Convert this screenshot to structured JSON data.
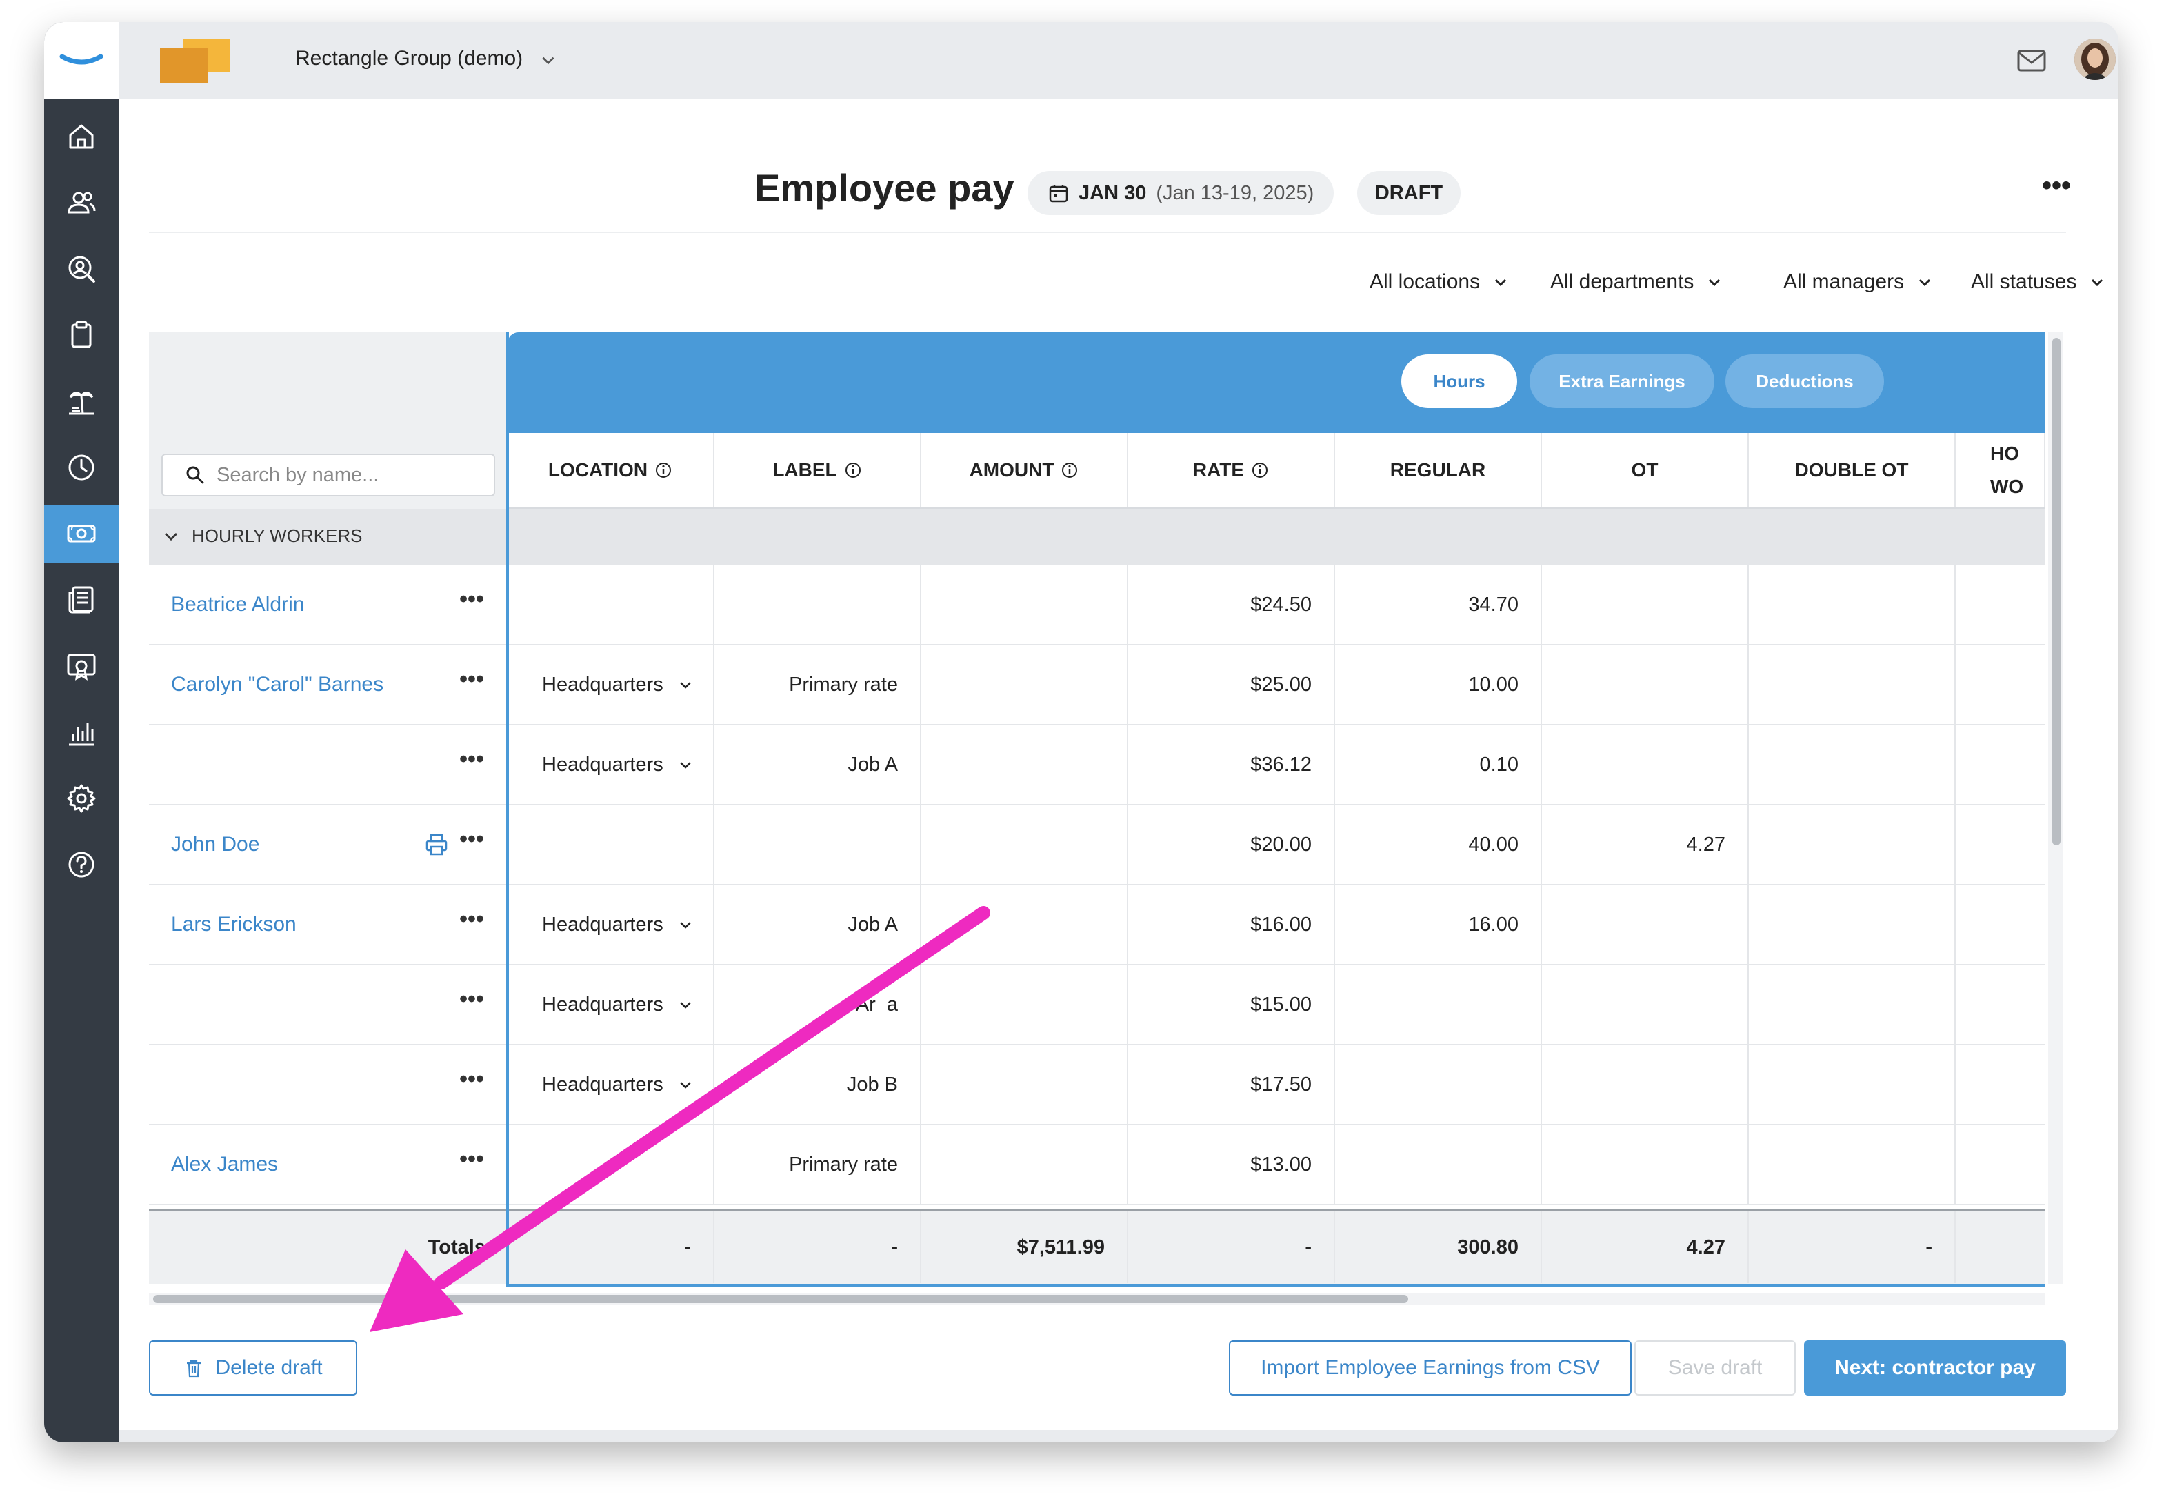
{
  "app": {
    "company_name": "Rectangle Group (demo)"
  },
  "sidebar": {
    "items": [
      {
        "icon": "home-icon"
      },
      {
        "icon": "people-icon"
      },
      {
        "icon": "search-person-icon"
      },
      {
        "icon": "clipboard-icon"
      },
      {
        "icon": "vacation-icon"
      },
      {
        "icon": "clock-icon"
      },
      {
        "icon": "payroll-icon",
        "active": true
      },
      {
        "icon": "reports-icon"
      },
      {
        "icon": "certificate-icon"
      },
      {
        "icon": "chart-icon"
      },
      {
        "icon": "gear-icon"
      },
      {
        "icon": "help-icon"
      }
    ]
  },
  "header": {
    "title": "Employee pay",
    "date_bold": "JAN 30",
    "date_range": "(Jan 13-19, 2025)",
    "status": "DRAFT",
    "more": "•••"
  },
  "filters": [
    "All locations",
    "All departments",
    "All managers",
    "All statuses"
  ],
  "search": {
    "placeholder": "Search by name..."
  },
  "segments": [
    "Hours",
    "Extra Earnings",
    "Deductions"
  ],
  "columns": [
    "LOCATION",
    "LABEL",
    "AMOUNT",
    "RATE",
    "REGULAR",
    "OT",
    "DOUBLE OT",
    "HO WO"
  ],
  "group": "HOURLY WORKERS",
  "rows": [
    {
      "name": "Beatrice Aldrin",
      "location": "",
      "label": "",
      "amount": "",
      "rate": "$24.50",
      "regular": "34.70",
      "ot": "",
      "double_ot": ""
    },
    {
      "name": "Carolyn \"Carol\" Barnes",
      "location": "Headquarters",
      "label": "Primary rate",
      "amount": "",
      "rate": "$25.00",
      "regular": "10.00",
      "ot": "",
      "double_ot": ""
    },
    {
      "name": "",
      "location": "Headquarters",
      "label": "Job A",
      "amount": "",
      "rate": "$36.12",
      "regular": "0.10",
      "ot": "",
      "double_ot": ""
    },
    {
      "name": "John Doe",
      "location": "",
      "label": "",
      "amount": "",
      "rate": "$20.00",
      "regular": "40.00",
      "ot": "4.27",
      "double_ot": ""
    },
    {
      "name": "Lars Erickson",
      "location": "Headquarters",
      "label": "Job A",
      "amount": "",
      "rate": "$16.00",
      "regular": "16.00",
      "ot": "",
      "double_ot": ""
    },
    {
      "name": "",
      "location": "Headquarters",
      "label": "Ar  a",
      "amount": "",
      "rate": "$15.00",
      "regular": "",
      "ot": "",
      "double_ot": ""
    },
    {
      "name": "",
      "location": "Headquarters",
      "label": "Job B",
      "amount": "",
      "rate": "$17.50",
      "regular": "",
      "ot": "",
      "double_ot": ""
    },
    {
      "name": "Alex James",
      "location": "",
      "label": "Primary rate",
      "amount": "",
      "rate": "$13.00",
      "regular": "",
      "ot": "",
      "double_ot": ""
    }
  ],
  "totals": {
    "label": "Totals",
    "location": "-",
    "label_col": "-",
    "amount": "$7,511.99",
    "rate": "-",
    "regular": "300.80",
    "ot": "4.27",
    "double_ot": "-"
  },
  "buttons": {
    "delete": "Delete draft",
    "import": "Import Employee Earnings from CSV",
    "save": "Save draft",
    "next": "Next: contractor pay"
  },
  "colors": {
    "accent": "#4a9ad8",
    "link": "#3b86c9",
    "sidebar": "#343b44",
    "annotation_arrow": "#ee2ac0"
  }
}
